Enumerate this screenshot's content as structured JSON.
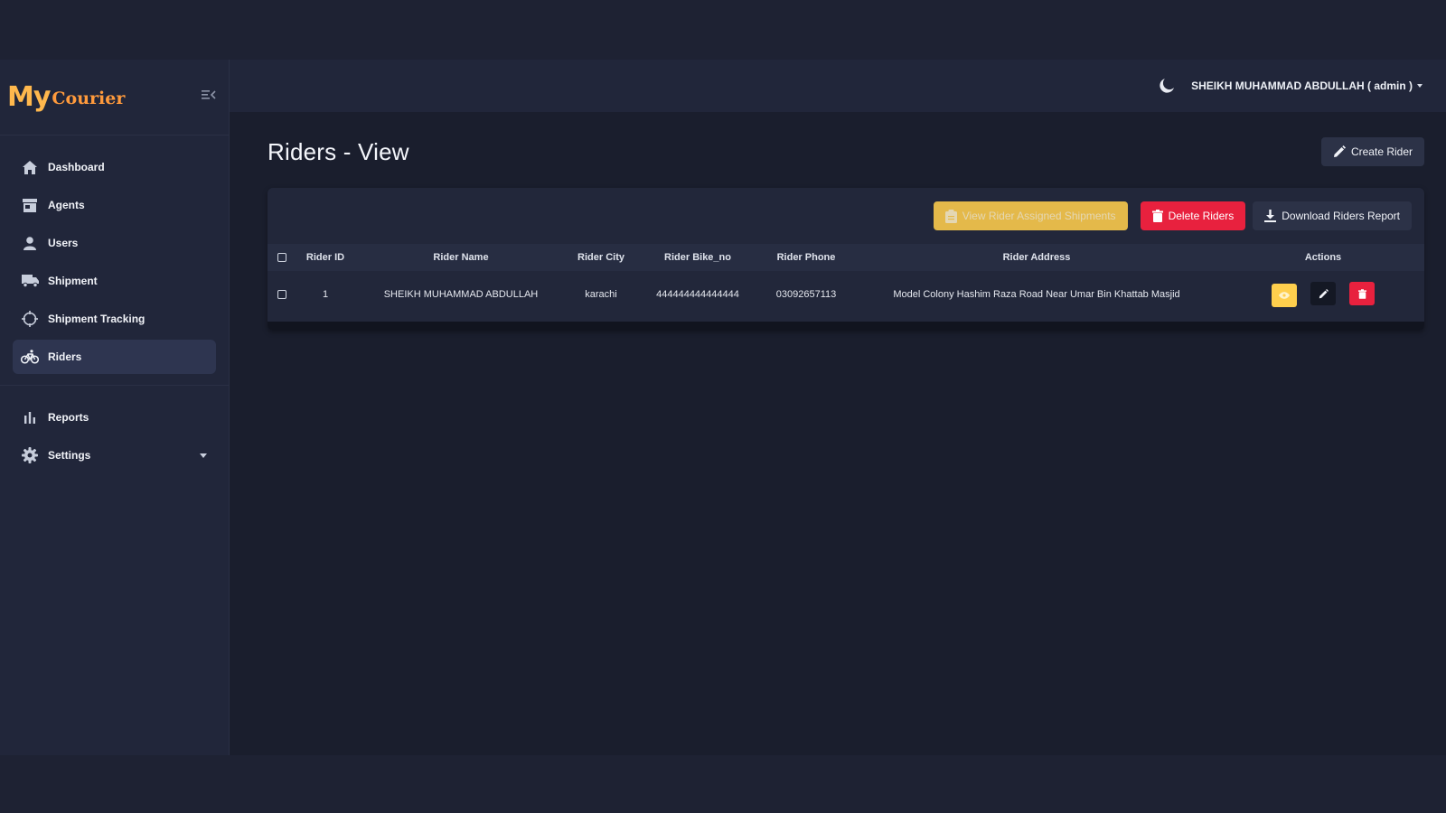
{
  "brand": {
    "logo_part1": "My",
    "logo_part2": "Courier"
  },
  "sidebar": {
    "items": [
      {
        "label": "Dashboard",
        "icon": "home-icon"
      },
      {
        "label": "Agents",
        "icon": "store-icon"
      },
      {
        "label": "Users",
        "icon": "user-icon"
      },
      {
        "label": "Shipment",
        "icon": "truck-icon"
      },
      {
        "label": "Shipment Tracking",
        "icon": "crosshair-icon"
      },
      {
        "label": "Riders",
        "icon": "bicycle-icon",
        "active": true
      }
    ],
    "secondary": [
      {
        "label": "Reports",
        "icon": "bar-chart-icon"
      },
      {
        "label": "Settings",
        "icon": "gear-icon"
      }
    ]
  },
  "topbar": {
    "user_label": "SHEIKH MUHAMMAD ABDULLAH ( admin )"
  },
  "page": {
    "title": "Riders - View",
    "create_button": "Create Rider"
  },
  "toolbar": {
    "view_assigned": "View Rider Assigned Shipments",
    "delete_riders": "Delete Riders",
    "download_report": "Download Riders Report"
  },
  "table": {
    "columns": [
      "Rider ID",
      "Rider Name",
      "Rider City",
      "Rider Bike_no",
      "Rider Phone",
      "Rider Address",
      "Actions"
    ],
    "rows": [
      {
        "id": "1",
        "name": "SHEIKH MUHAMMAD ABDULLAH",
        "city": "karachi",
        "bike_no": "444444444444444",
        "phone": "03092657113",
        "address": "Model Colony Hashim Raza Road Near Umar Bin Khattab Masjid"
      }
    ]
  },
  "colors": {
    "accent_yellow": "#ffcf4d",
    "accent_red": "#e8213e",
    "logo_orange": "#ff9a3c",
    "sidebar_bg": "#21263a",
    "main_bg": "#1a1e2d"
  }
}
